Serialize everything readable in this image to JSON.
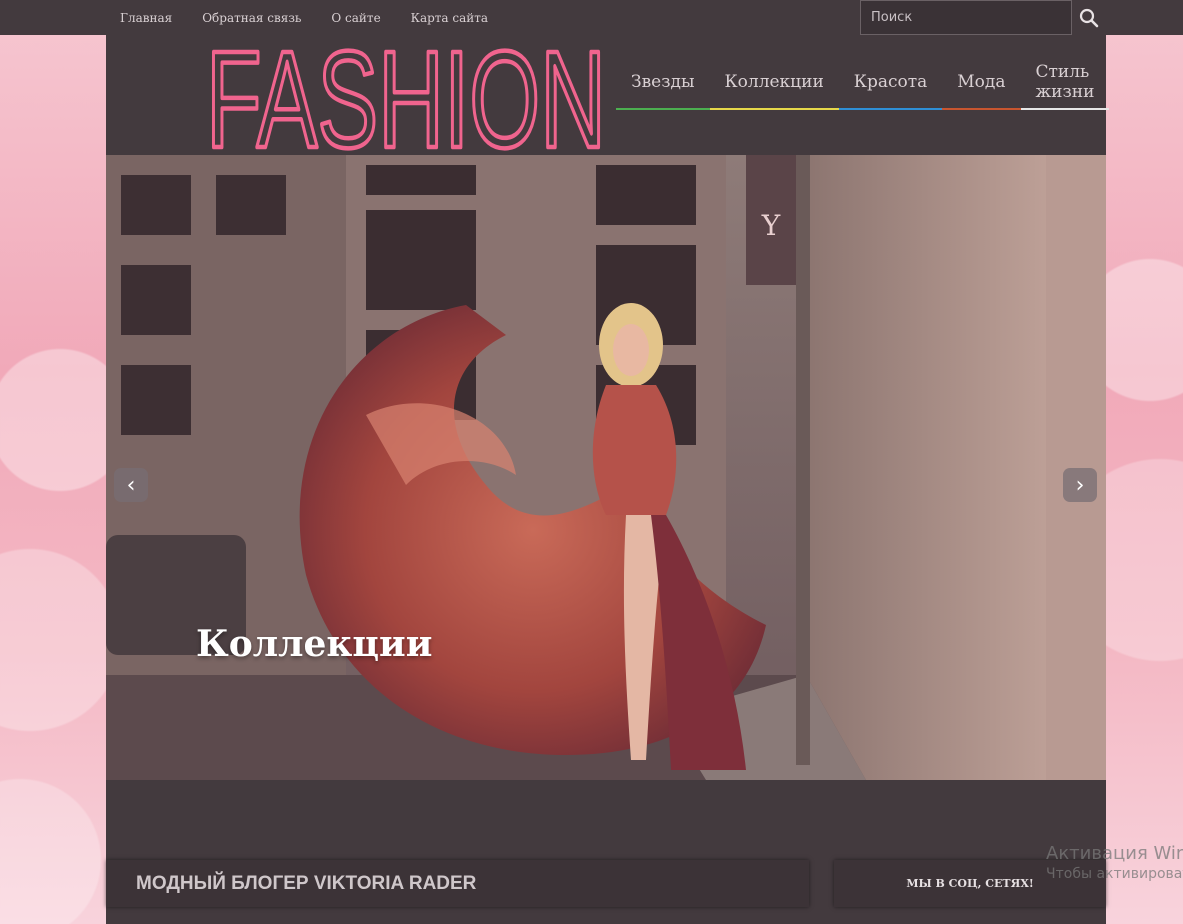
{
  "topbar": {
    "links": [
      "Главная",
      "Обратная связь",
      "О сайте",
      "Карта сайта"
    ],
    "search_placeholder": "Поиск"
  },
  "header": {
    "logo_text": "FASHION",
    "nav": [
      {
        "label": "Звезды",
        "color": "#4caf50"
      },
      {
        "label": "Коллекции",
        "color": "#e6d84a"
      },
      {
        "label": "Красота",
        "color": "#2f8fd6"
      },
      {
        "label": "Мода",
        "color": "#c8552f"
      },
      {
        "label": "Стиль жизни",
        "color": "#e6e6e6"
      }
    ]
  },
  "slider": {
    "caption": "Коллекции",
    "prev_icon": "‹",
    "next_icon": "›"
  },
  "sections": {
    "blog_title": "МОДНЫЙ БЛОГЕР VIKTORIA RADER",
    "social_title": "МЫ В СОЦ, СЕТЯХ!"
  },
  "watermark": {
    "line1": "Активация Win",
    "line2": "Чтобы активироват"
  },
  "colors": {
    "logo_pink": "#f0648e",
    "bar_bg": "#433a3e"
  }
}
